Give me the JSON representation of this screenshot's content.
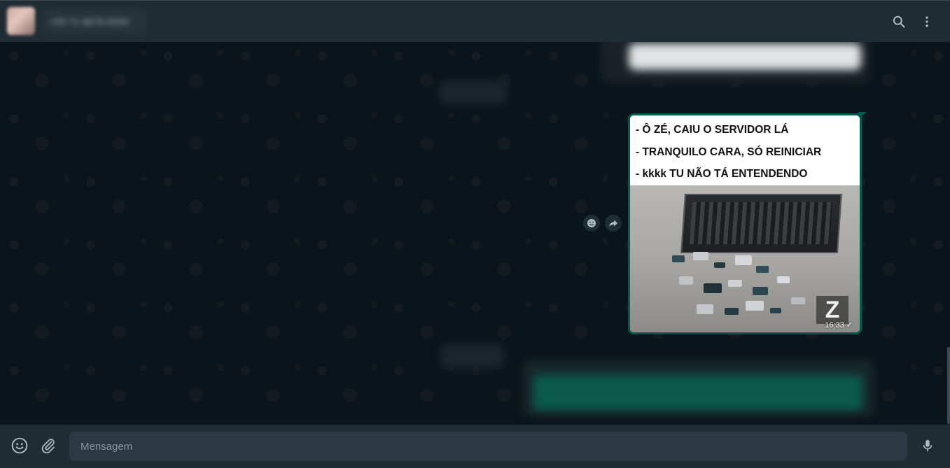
{
  "header": {
    "contact_name": "+55 71 9876-0000",
    "search_icon": "search-icon",
    "menu_icon": "more-vertical-icon"
  },
  "chat": {
    "image_message": {
      "caption_lines": [
        "- Ô ZÉ, CAIU O SERVIDOR LÁ",
        "- TRANQUILO CARA, SÓ REINICIAR",
        "- kkkk TU NÃO TÁ ENTENDENDO"
      ],
      "watermark": "Z",
      "time": "16:33",
      "status": "✓"
    },
    "reaction_icon": "emoji-reaction-icon",
    "forward_icon": "forward-icon"
  },
  "footer": {
    "placeholder": "Mensagem",
    "emoji_icon": "emoji-icon",
    "attach_icon": "paperclip-icon",
    "mic_icon": "microphone-icon"
  },
  "colors": {
    "header_bg": "#202c33",
    "chat_bg": "#0b141a",
    "outgoing_bubble": "#005c4b",
    "input_bg": "#2a3942"
  }
}
